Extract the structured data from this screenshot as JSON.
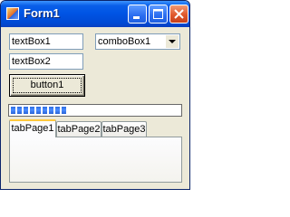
{
  "window": {
    "title": "Form1",
    "icons": {
      "app": "form-app-icon",
      "minimize": "minimize-icon",
      "maximize": "maximize-icon",
      "close": "close-icon"
    },
    "colors": {
      "titlebar": "#0055e5",
      "close_button": "#e0582c",
      "client": "#ece9d8"
    }
  },
  "form": {
    "textBox1": {
      "value": "textBox1"
    },
    "textBox2": {
      "value": "textBox2"
    },
    "comboBox1": {
      "selected": "comboBox1",
      "icon": "chevron-down-icon"
    },
    "button1": {
      "label": "button1"
    },
    "progressBar1": {
      "value_percent": 33,
      "segment_color": "#2f6de0"
    },
    "tabControl1": {
      "tabs": [
        {
          "label": "tabPage1",
          "selected": true
        },
        {
          "label": "tabPage2",
          "selected": false
        },
        {
          "label": "tabPage3",
          "selected": false
        }
      ]
    }
  }
}
